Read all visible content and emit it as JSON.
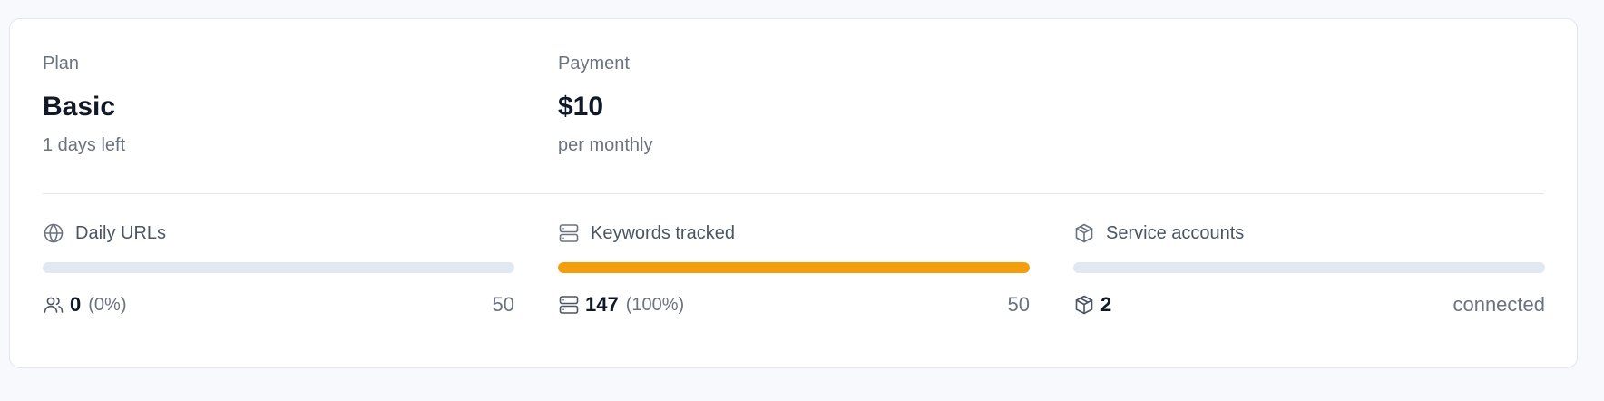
{
  "plan": {
    "label": "Plan",
    "name": "Basic",
    "days_left": "1 days left"
  },
  "payment": {
    "label": "Payment",
    "amount": "$10",
    "period": "per monthly"
  },
  "metrics": [
    {
      "title": "Daily URLs",
      "icon": "globe-icon",
      "foot_icon": "users-icon",
      "count": "0",
      "percent_text": "(0%)",
      "limit": "50",
      "progress": 0,
      "bar_color": "#f59e0b"
    },
    {
      "title": "Keywords tracked",
      "icon": "server-icon",
      "foot_icon": "server-icon",
      "count": "147",
      "percent_text": "(100%)",
      "limit": "50",
      "progress": 1,
      "bar_color": "#f59e0b"
    },
    {
      "title": "Service accounts",
      "icon": "box-icon",
      "foot_icon": "box-icon",
      "count": "2",
      "limit": "connected",
      "progress": 0,
      "bar_color": "#f59e0b"
    }
  ],
  "colors": {
    "accent": "#f59e0b",
    "track": "#e2e8ef"
  }
}
